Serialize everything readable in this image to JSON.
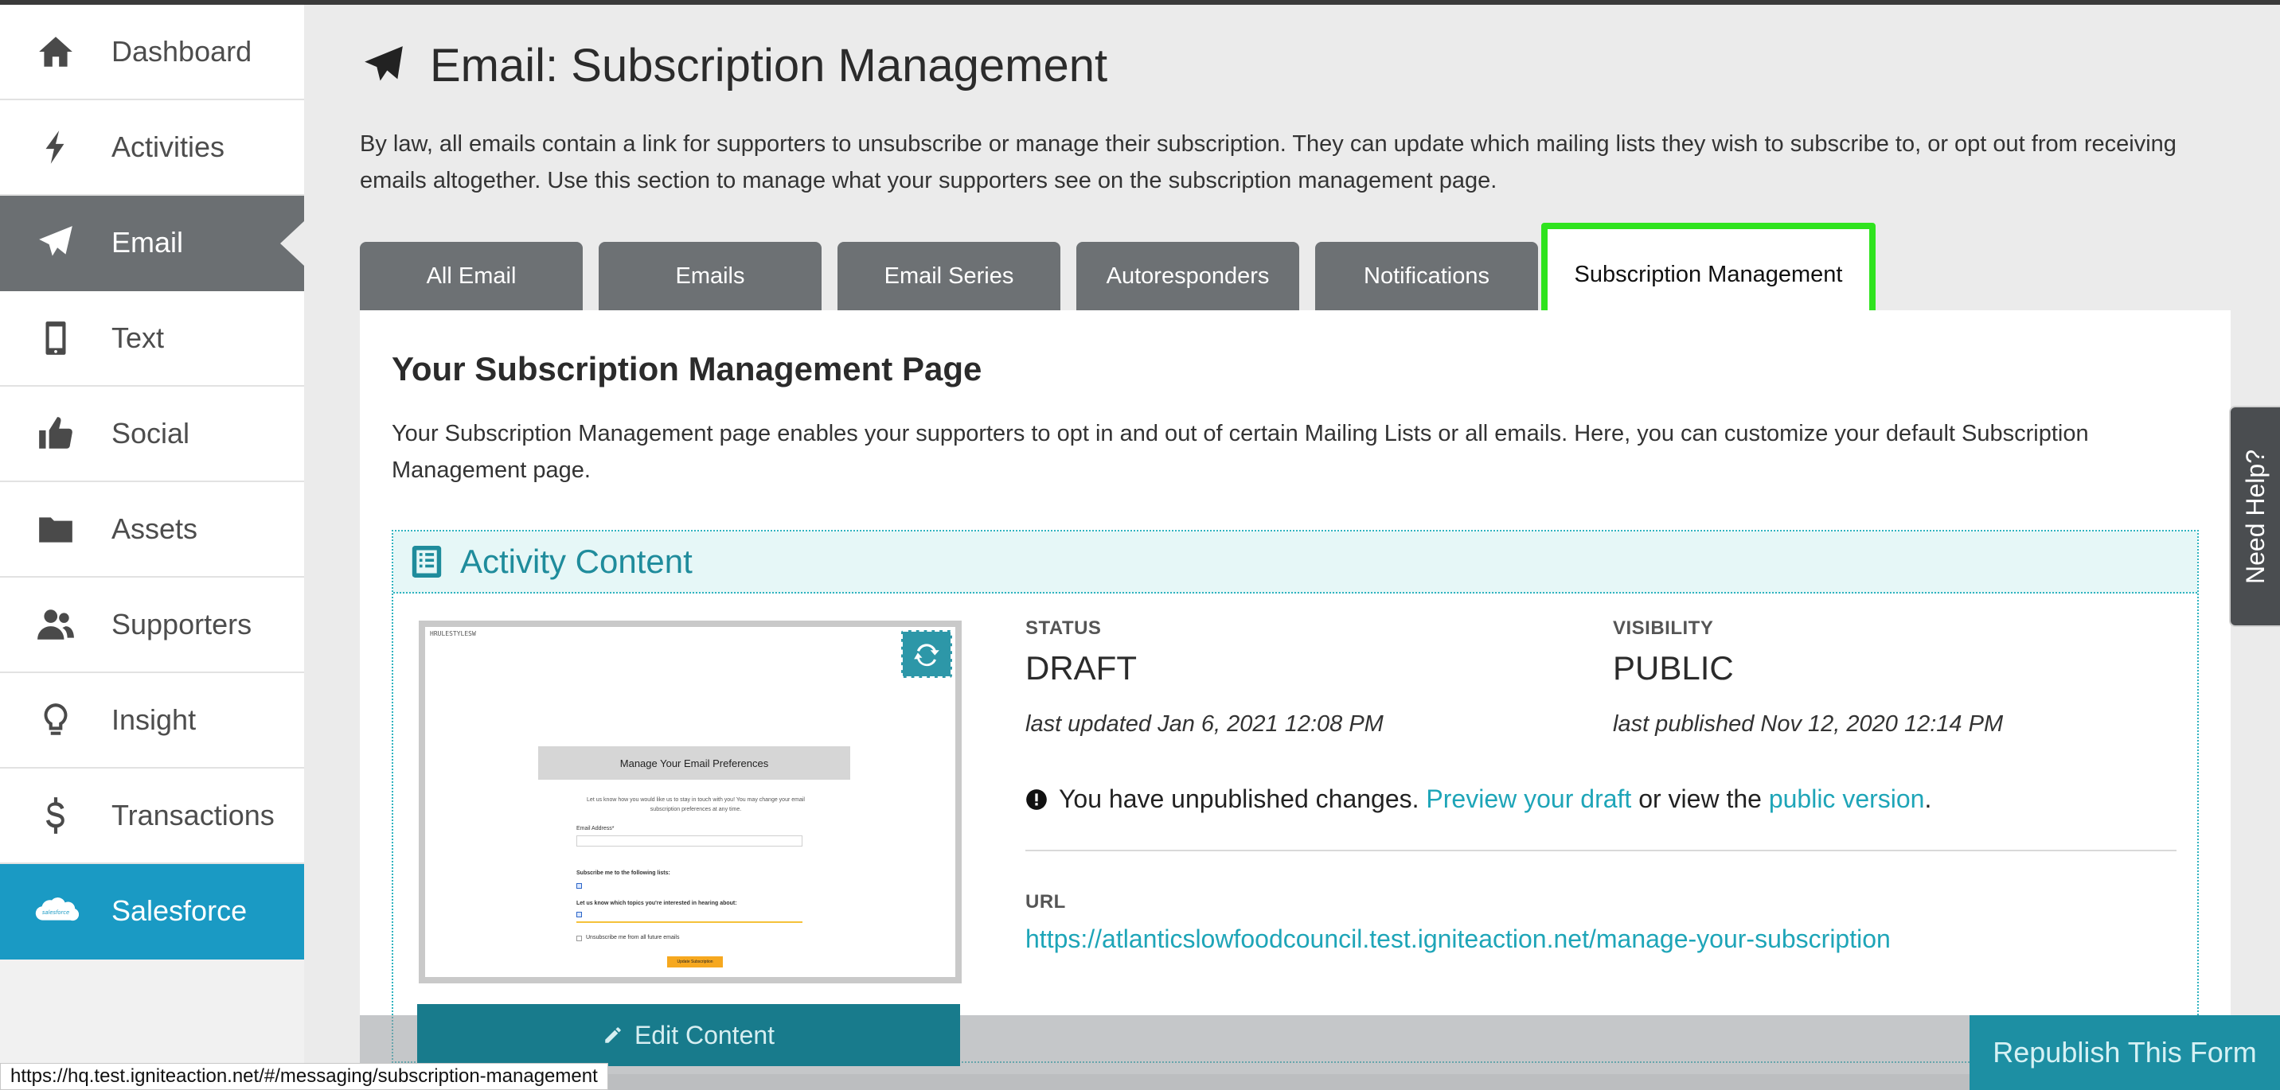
{
  "sidebar": {
    "items": [
      {
        "label": "Dashboard",
        "icon": "home-icon"
      },
      {
        "label": "Activities",
        "icon": "bolt-icon"
      },
      {
        "label": "Email",
        "icon": "paper-plane-icon"
      },
      {
        "label": "Text",
        "icon": "mobile-icon"
      },
      {
        "label": "Social",
        "icon": "thumbs-up-icon"
      },
      {
        "label": "Assets",
        "icon": "folder-icon"
      },
      {
        "label": "Supporters",
        "icon": "users-icon"
      },
      {
        "label": "Insight",
        "icon": "lightbulb-icon"
      },
      {
        "label": "Transactions",
        "icon": "dollar-icon"
      },
      {
        "label": "Salesforce",
        "icon": "salesforce-cloud-icon"
      }
    ],
    "active": "Email",
    "salesforce_logo_text": "salesforce"
  },
  "header": {
    "title": "Email: Subscription Management",
    "intro": "By law, all emails contain a link for supporters to unsubscribe or manage their subscription. They can update which mailing lists they wish to subscribe to, or opt out from receiving emails altogether. Use this section to manage what your supporters see on the subscription management page."
  },
  "tabs": [
    {
      "label": "All Email"
    },
    {
      "label": "Emails"
    },
    {
      "label": "Email Series"
    },
    {
      "label": "Autoresponders"
    },
    {
      "label": "Notifications"
    },
    {
      "label": "Subscription Management"
    }
  ],
  "section": {
    "title": "Your Subscription Management Page",
    "description": "Your Subscription Management page enables your supporters to opt in and out of certain Mailing Lists or all emails. Here, you can customize your default Subscription Management page."
  },
  "activity": {
    "title": "Activity Content",
    "thumbnail": {
      "tag": "HRULESTYLESW",
      "heading": "Manage Your Email Preferences",
      "text": "Let us know how you would like us to stay in touch with you! You may change your email subscription preferences at any time.",
      "email_label": "Email Address*",
      "subscribe_label": "Subscribe me to the following lists:",
      "topics_label": "Let us know which topics you're interested in hearing about:",
      "unsubscribe_label": "Unsubscribe me from all future emails",
      "button": "Update Subscription"
    },
    "edit_label": "Edit Content",
    "status_label": "STATUS",
    "status_value": "DRAFT",
    "last_updated": "last updated Jan 6, 2021 12:08 PM",
    "visibility_label": "VISIBILITY",
    "visibility_value": "PUBLIC",
    "last_published": "last published Nov 12, 2020 12:14 PM",
    "unpublished_prefix": "You have unpublished changes.",
    "preview_link": "Preview your draft",
    "unpublished_middle": "or view the",
    "public_link": "public version",
    "unpublished_suffix": ".",
    "url_label": "URL",
    "url_value": "https://atlanticslowfoodcouncil.test.igniteaction.net/manage-your-subscription"
  },
  "footer": {
    "republish_label": "Republish This Form"
  },
  "help": {
    "label": "Need Help?"
  },
  "status_bar": {
    "url": "https://hq.test.igniteaction.net/#/messaging/subscription-management"
  },
  "colors": {
    "accent": "#1ea5b8",
    "tab_gray": "#6d7174",
    "highlight": "#2fe31e",
    "salesforce": "#1a9ac4"
  }
}
